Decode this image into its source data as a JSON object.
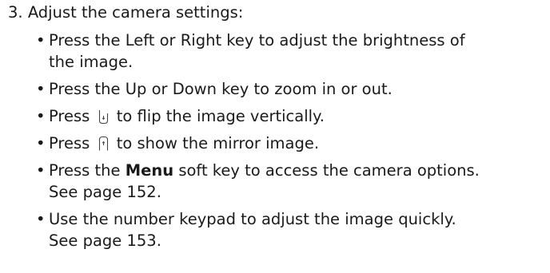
{
  "step": {
    "number": "3.",
    "text": "Adjust the camera settings:"
  },
  "bullets": [
    {
      "line1": "Press the Left or Right key to adjust the brightness of",
      "line2": "the image."
    },
    {
      "line1": "Press the Up or Down key to zoom in or out."
    },
    {
      "before": "Press",
      "after": "to flip the image vertically.",
      "icon": "flip-vertical-key-icon"
    },
    {
      "before": "Press",
      "after": "to show the mirror image.",
      "icon": "mirror-key-icon"
    },
    {
      "before": "Press the",
      "bold": "Menu",
      "after": "soft key to access the camera options.",
      "line2": "See page 152."
    },
    {
      "line1": "Use the number keypad to adjust the image quickly.",
      "line2": "See page 153."
    }
  ]
}
